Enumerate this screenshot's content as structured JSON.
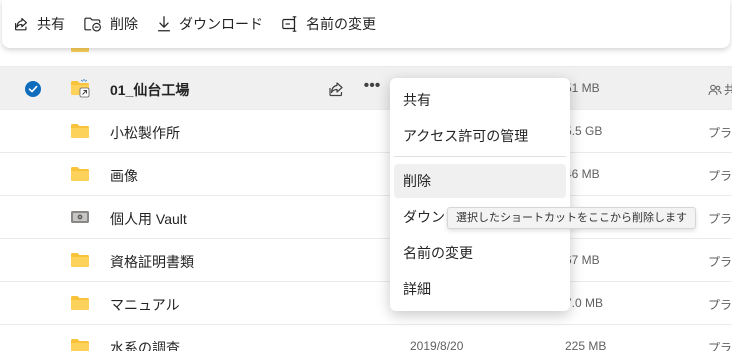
{
  "toolbar": {
    "share_label": "共有",
    "delete_label": "削除",
    "download_label": "ダウンロード",
    "rename_label": "名前の変更"
  },
  "rows": [
    {
      "name": "",
      "modified": "",
      "size": "",
      "sharing": "",
      "icon": "folder-icon"
    },
    {
      "name": "01_仙台工場",
      "modified": "",
      "size": "51 MB",
      "sharing": "共",
      "icon": "shortcut-folder-icon",
      "selected": true
    },
    {
      "name": "小松製作所",
      "modified": "",
      "size": "5.5 GB",
      "sharing": "プライ",
      "icon": "folder-icon"
    },
    {
      "name": "画像",
      "modified": "",
      "size": "46 MB",
      "sharing": "プライ",
      "icon": "folder-icon"
    },
    {
      "name": "個人用 Vault",
      "modified": "",
      "size": "",
      "sharing": "プライ",
      "icon": "vault-icon"
    },
    {
      "name": "資格証明書類",
      "modified": "",
      "size": "67 MB",
      "sharing": "プライ",
      "icon": "folder-icon"
    },
    {
      "name": "マニュアル",
      "modified": "",
      "size": "7.0 MB",
      "sharing": "プライ",
      "icon": "folder-icon"
    },
    {
      "name": "水系の調査",
      "modified": "2019/8/20",
      "size": "225 MB",
      "sharing": "プライ",
      "icon": "folder-icon"
    }
  ],
  "context_menu": {
    "items": [
      "共有",
      "アクセス許可の管理",
      "削除",
      "ダウンロード",
      "名前の変更",
      "詳細"
    ]
  },
  "tooltip": {
    "text": "選択したショートカットをここから削除します"
  },
  "colors": {
    "accent": "#0f6cbd",
    "folder": "#f8c33a",
    "selected_row": "#f0f0f0"
  }
}
